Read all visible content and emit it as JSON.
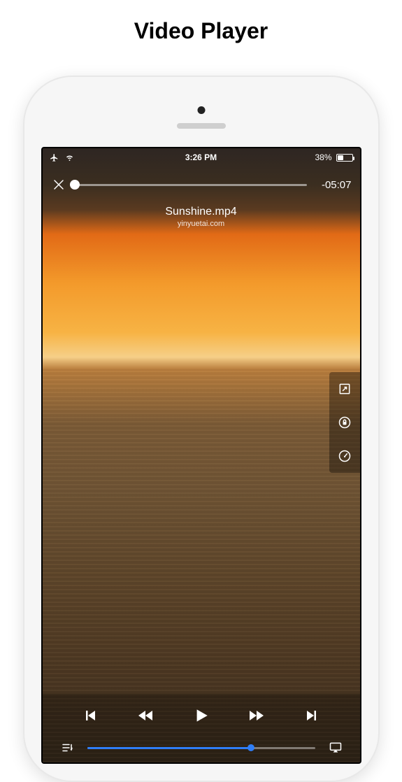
{
  "page": {
    "title": "Video Player"
  },
  "status_bar": {
    "time": "3:26 PM",
    "battery_pct": "38%",
    "battery_fill_pct": 38
  },
  "player": {
    "time_remaining": "-05:07",
    "progress_pct": 0,
    "file_name": "Sunshine.mp4",
    "source": "yinyuetai.com"
  },
  "seek": {
    "fill_pct": 72
  },
  "icons": {
    "airplane": "airplane-icon",
    "wifi": "wifi-icon",
    "close": "close-icon",
    "expand": "expand-icon",
    "lock": "lock-icon",
    "speed": "speedometer-icon",
    "prev": "previous-track-icon",
    "rw": "rewind-icon",
    "play": "play-icon",
    "ff": "fast-forward-icon",
    "next": "next-track-icon",
    "queue": "queue-icon",
    "airplay": "airplay-icon"
  }
}
